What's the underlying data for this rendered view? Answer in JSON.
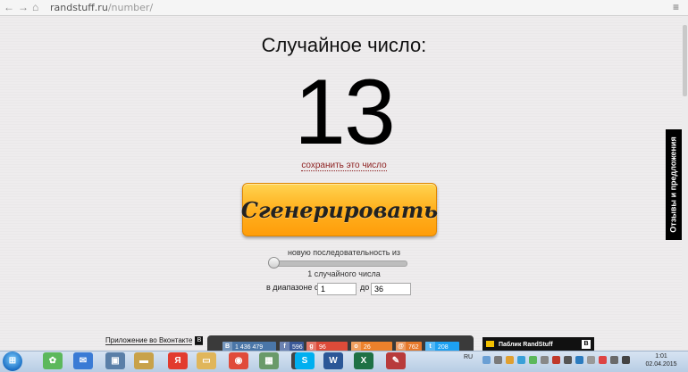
{
  "browser": {
    "back_icon": "back-arrow-icon",
    "forward_icon": "forward-arrow-icon",
    "url_host": "randstuff.ru",
    "url_path": "/number/",
    "menu_icon": "menu-icon"
  },
  "main": {
    "title": "Случайное число:",
    "number": "13",
    "save_link": "сохранить это число",
    "generate_button": "Сгенерировать",
    "sequence_label": "новую последовательность из",
    "count_label": "1 случайного числа",
    "range_label_from": "в диапазоне от",
    "range_from": "1",
    "range_label_to": "до",
    "range_to": "36",
    "count_slider_value": 1
  },
  "feedback_tab": "Отзывы и предложения",
  "bottom": {
    "vk_app": "Приложение во Вконтакте",
    "vk_badge": "В",
    "shares": [
      {
        "network": "vk",
        "icon": "В",
        "count": "1 436 479",
        "color": "#4a76a8"
      },
      {
        "network": "facebook",
        "icon": "f",
        "count": "596",
        "color": "#3b5998"
      },
      {
        "network": "google-plus",
        "icon": "g",
        "count": "96",
        "color": "#dd4b39"
      },
      {
        "network": "odnoklassniki",
        "icon": "o",
        "count": "26",
        "color": "#ed812b"
      },
      {
        "network": "mailru",
        "icon": "@",
        "count": "762",
        "color": "#e6792b"
      },
      {
        "network": "twitter",
        "icon": "t",
        "count": "208",
        "color": "#1da1f2"
      }
    ],
    "public_label": "Паблик RandStuff",
    "public_badge": "В"
  },
  "taskbar": {
    "apps": [
      {
        "name": "icq",
        "color": "#5cb85c",
        "glyph": "✿"
      },
      {
        "name": "mail",
        "color": "#3a7bd5",
        "glyph": "✉"
      },
      {
        "name": "computer",
        "color": "#5a7fa8",
        "glyph": "▣"
      },
      {
        "name": "folder",
        "color": "#c8a24a",
        "glyph": "▬"
      },
      {
        "name": "yandex",
        "color": "#e23b2e",
        "glyph": "Я"
      },
      {
        "name": "explorer",
        "color": "#e0b65a",
        "glyph": "▭"
      },
      {
        "name": "chrome",
        "color": "#e04b3a",
        "glyph": "◉"
      },
      {
        "name": "photo",
        "color": "#6a9a6a",
        "glyph": "▦"
      },
      {
        "name": "video",
        "color": "#444",
        "glyph": "▶"
      },
      {
        "name": "skype",
        "color": "#00aff0",
        "glyph": "S"
      },
      {
        "name": "word",
        "color": "#2b5797",
        "glyph": "W"
      },
      {
        "name": "excel",
        "color": "#1e7145",
        "glyph": "X"
      },
      {
        "name": "paint",
        "color": "#b83b3b",
        "glyph": "✎"
      }
    ],
    "lang": "RU",
    "time": "1:01",
    "date": "02.04.2015"
  }
}
